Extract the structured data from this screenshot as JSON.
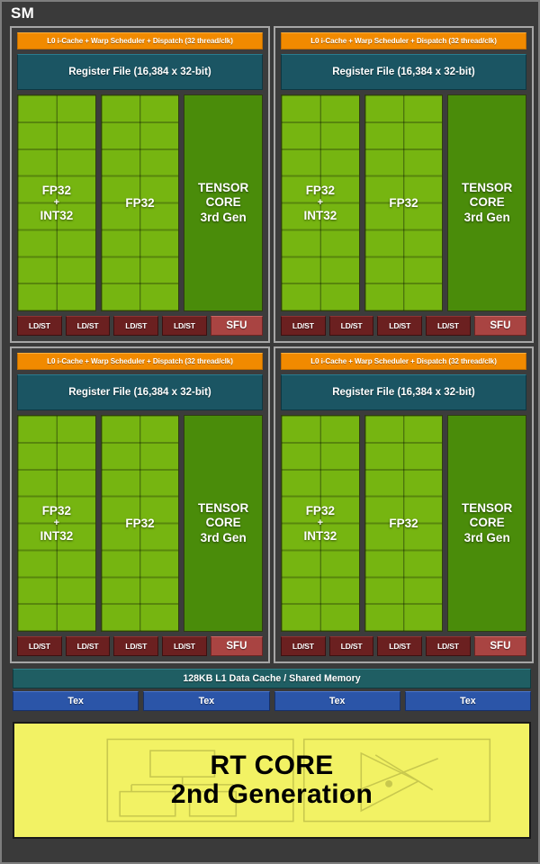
{
  "diagram": {
    "title": "SM",
    "colors": {
      "background": "#3a3a3a",
      "panel_border": "#a6a6a6",
      "scheduler_orange": "#f18a00",
      "register_teal": "#1b5563",
      "fp32_green": "#76b511",
      "tensor_green": "#4a8c0a",
      "ldst_maroon": "#6b2020",
      "sfu_red": "#a94442",
      "l1_teal": "#1f5e63",
      "tex_blue": "#2b55a8",
      "rtcore_yellow": "#f2f264"
    }
  },
  "processing_blocks": [
    {
      "id": "block-1",
      "scheduler": "L0 i-Cache + Warp Scheduler + Dispatch (32 thread/clk)",
      "register_file": "Register File (16,384 x 32-bit)",
      "units": [
        {
          "name": "fp32-int32",
          "line1": "FP32",
          "plus": "+",
          "line2": "INT32",
          "columns": 2,
          "rows": 8
        },
        {
          "name": "fp32",
          "line1": "FP32",
          "columns": 2,
          "rows": 8
        },
        {
          "name": "tensor-core",
          "line1": "TENSOR",
          "line2": "CORE",
          "line3": "3rd Gen"
        }
      ],
      "ldst": [
        "LD/ST",
        "LD/ST",
        "LD/ST",
        "LD/ST"
      ],
      "sfu": "SFU"
    },
    {
      "id": "block-2",
      "scheduler": "L0 i-Cache + Warp Scheduler + Dispatch (32 thread/clk)",
      "register_file": "Register File (16,384 x 32-bit)",
      "units": [
        {
          "name": "fp32-int32",
          "line1": "FP32",
          "plus": "+",
          "line2": "INT32",
          "columns": 2,
          "rows": 8
        },
        {
          "name": "fp32",
          "line1": "FP32",
          "columns": 2,
          "rows": 8
        },
        {
          "name": "tensor-core",
          "line1": "TENSOR",
          "line2": "CORE",
          "line3": "3rd Gen"
        }
      ],
      "ldst": [
        "LD/ST",
        "LD/ST",
        "LD/ST",
        "LD/ST"
      ],
      "sfu": "SFU"
    },
    {
      "id": "block-3",
      "scheduler": "L0 i-Cache + Warp Scheduler + Dispatch (32 thread/clk)",
      "register_file": "Register File (16,384 x 32-bit)",
      "units": [
        {
          "name": "fp32-int32",
          "line1": "FP32",
          "plus": "+",
          "line2": "INT32",
          "columns": 2,
          "rows": 8
        },
        {
          "name": "fp32",
          "line1": "FP32",
          "columns": 2,
          "rows": 8
        },
        {
          "name": "tensor-core",
          "line1": "TENSOR",
          "line2": "CORE",
          "line3": "3rd Gen"
        }
      ],
      "ldst": [
        "LD/ST",
        "LD/ST",
        "LD/ST",
        "LD/ST"
      ],
      "sfu": "SFU"
    },
    {
      "id": "block-4",
      "scheduler": "L0 i-Cache + Warp Scheduler + Dispatch (32 thread/clk)",
      "register_file": "Register File (16,384 x 32-bit)",
      "units": [
        {
          "name": "fp32-int32",
          "line1": "FP32",
          "plus": "+",
          "line2": "INT32",
          "columns": 2,
          "rows": 8
        },
        {
          "name": "fp32",
          "line1": "FP32",
          "columns": 2,
          "rows": 8
        },
        {
          "name": "tensor-core",
          "line1": "TENSOR",
          "line2": "CORE",
          "line3": "3rd Gen"
        }
      ],
      "ldst": [
        "LD/ST",
        "LD/ST",
        "LD/ST",
        "LD/ST"
      ],
      "sfu": "SFU"
    }
  ],
  "l1_cache": "128KB L1 Data Cache / Shared Memory",
  "tex_units": [
    "Tex",
    "Tex",
    "Tex",
    "Tex"
  ],
  "rt_core": {
    "line1": "RT CORE",
    "line2": "2nd Generation",
    "graphics": [
      "bvh-tree-icon",
      "ray-triangle-intersection-icon"
    ]
  }
}
